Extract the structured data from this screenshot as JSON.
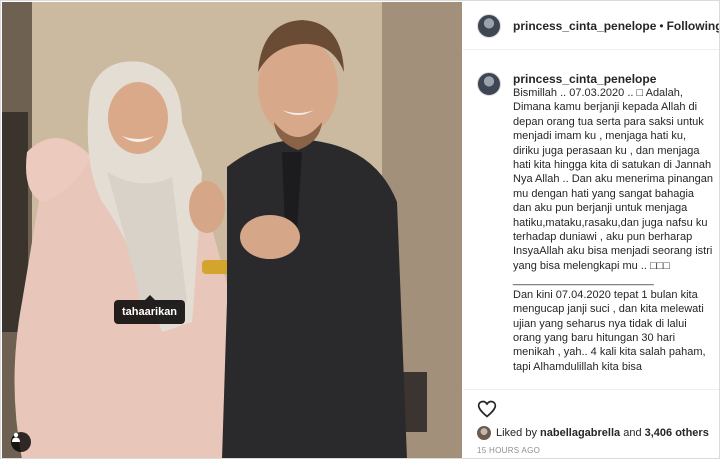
{
  "post": {
    "username": "princess_cinta_penelope",
    "follow_separator": "•",
    "follow_status": "Following",
    "photo": {
      "tag_label": "tahaarikan"
    },
    "caption": {
      "username": "princess_cinta_penelope",
      "text": "Bismillah .. 07.03.2020 .. □ Adalah, Dimana kamu berjanji kepada Allah di depan orang tua serta para saksi untuk menjadi imam ku , menjaga hati ku, diriku juga perasaan ku , dan menjaga hati kita hingga kita di satukan di Jannah Nya Allah .. Dan aku menerima pinangan mu dengan hati yang sangat bahagia dan aku pun berjanji untuk menjaga hatiku,mataku,rasaku,dan juga nafsu ku terhadap duniawi , aku pun berharap InsyaAllah aku bisa menjadi seorang istri yang bisa melengkapi mu .. □□□\n_______________________\nDan kini 07.04.2020 tepat 1 bulan kita mengucap janji suci , dan kita melewati ujian yang seharus nya tidak di lalui orang yang baru hitungan 30 hari menikah , yah.. 4 kali kita salah paham, tapi Alhamdulillah kita bisa"
    },
    "likes": {
      "prefix": "Liked by",
      "first_liker": "nabellagabrella",
      "connector": "and",
      "others_count": "3,406 others"
    },
    "timestamp": "15 HOURS AGO",
    "icons": {
      "like": "heart-icon",
      "save": "bookmark-icon",
      "user_tags": "person-icon"
    },
    "colors": {
      "text": "#262626",
      "muted": "#8e8e8e",
      "border": "#dbdbdb",
      "dress": "#e8c4b8",
      "suit": "#2a2a2d"
    }
  }
}
